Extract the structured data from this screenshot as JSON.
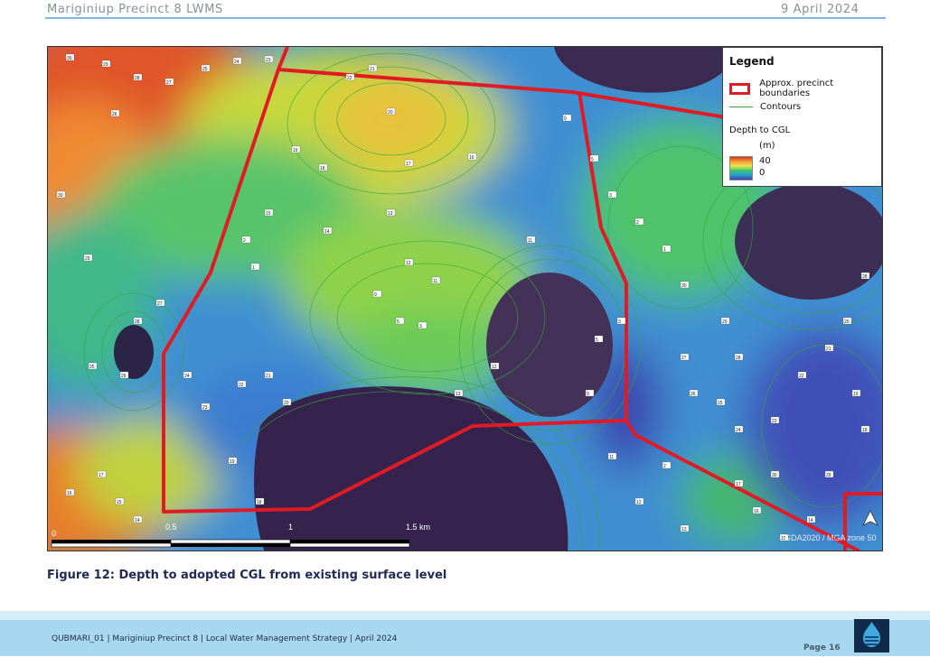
{
  "header": {
    "left": "Mariginiup Precinct 8 LWMS",
    "right": "9 April 2024"
  },
  "legend": {
    "title": "Legend",
    "boundary_label": "Approx. precinct boundaries",
    "contours_label": "Contours",
    "depth_title": "Depth to CGL",
    "unit": "(m)",
    "ramp_max": "40",
    "ramp_min": "0",
    "colors": {
      "boundary": "#e01b24",
      "contour": "#3aa63a",
      "ramp": [
        "#d6301f",
        "#f7a13a",
        "#e8e84a",
        "#39c36d",
        "#2b9ad6",
        "#4242a8"
      ]
    }
  },
  "scalebar": {
    "tick_0": "0",
    "tick_0_5": "0.5",
    "tick_1": "1",
    "tick_1_5": "1.5 km"
  },
  "map": {
    "crs_label": "GDA2020 / MGA zone 50",
    "north_icon": "north-arrow-icon",
    "depth_labels": [
      "30",
      "29",
      "28",
      "27",
      "26",
      "25",
      "24",
      "23",
      "22",
      "21",
      "20",
      "19",
      "18",
      "17",
      "16",
      "15",
      "14",
      "13",
      "12",
      "11",
      "9",
      "5",
      "3",
      "2",
      "1"
    ]
  },
  "caption": "Figure 12: Depth to adopted CGL from existing surface level",
  "footer": {
    "text": "QUBMARI_01 | Mariginiup Precinct 8 | Local Water Management Strategy | April 2024",
    "page": "Page 16",
    "logo_icon": "water-drop-logo-icon"
  }
}
